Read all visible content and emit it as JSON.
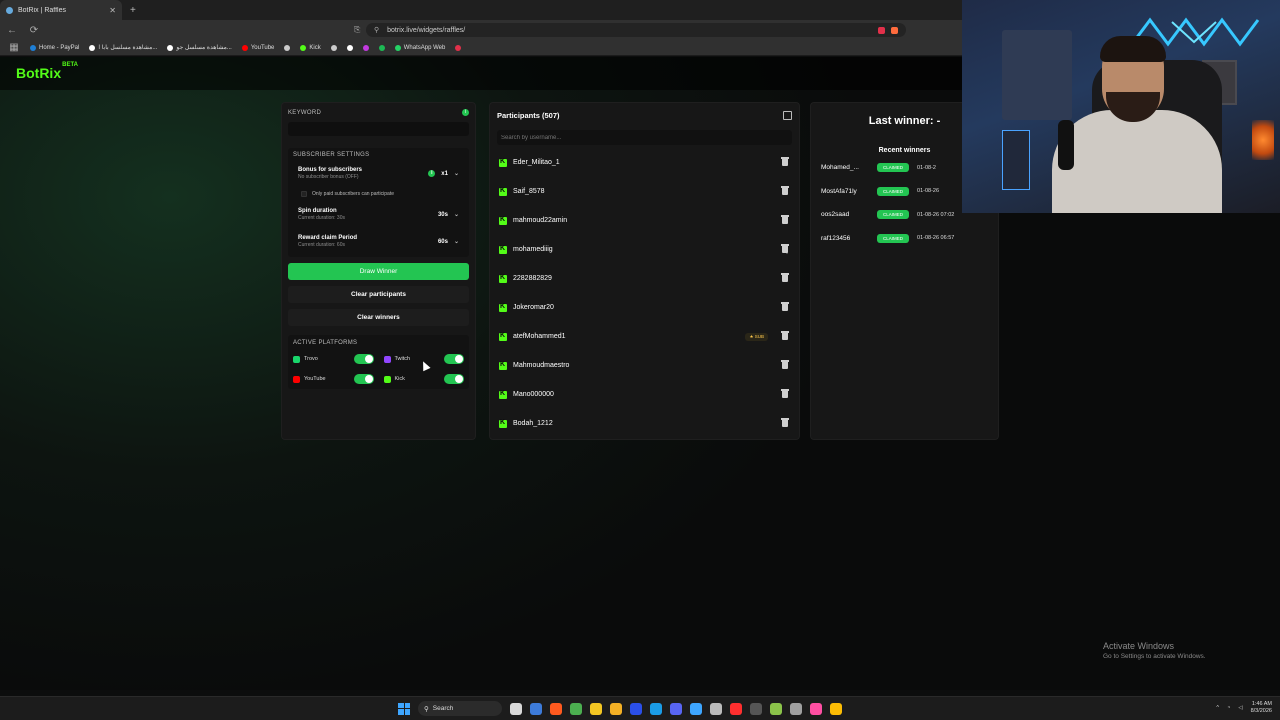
{
  "browser": {
    "tab_title": "BotRix | Raffles",
    "tab_close": "✕",
    "new_tab": "+",
    "url": "botrix.live/widgets/raffles/",
    "bookmarks": [
      {
        "label": "Home - PayPal",
        "color": "#1e7fd6"
      },
      {
        "label": "مشاهدة مسلسل بابا ا...",
        "color": "#ffffff"
      },
      {
        "label": "مشاهدة مسلسل جو...",
        "color": "#ffffff"
      },
      {
        "label": "YouTube",
        "color": "#ff0000"
      },
      {
        "label": "",
        "color": "#cccccc"
      },
      {
        "label": "Kick",
        "color": "#53fc18"
      },
      {
        "label": "",
        "color": "#cccccc"
      },
      {
        "label": "",
        "color": "#ffffff"
      },
      {
        "label": "",
        "color": "#c23adf"
      },
      {
        "label": "",
        "color": "#1db954"
      },
      {
        "label": "WhatsApp Web",
        "color": "#25d366"
      },
      {
        "label": "",
        "color": "#e2304a"
      }
    ]
  },
  "app": {
    "logo": "BotRix",
    "logo_badge": "BETA"
  },
  "left_panel": {
    "keyword_label": "KEYWORD",
    "keyword_value": "",
    "subscriber_settings_label": "SUBSCRIBER SETTINGS",
    "bonus_title": "Bonus for subscribers",
    "bonus_desc": "No subscriber bonus (OFF)",
    "bonus_value": "x1",
    "paid_only_label": "Only paid subscribers can participate",
    "spin_title": "Spin duration",
    "spin_desc": "Current duration: 30s",
    "spin_value": "30s",
    "reward_title": "Reward claim Period",
    "reward_desc": "Current duration: 60s",
    "reward_value": "60s",
    "draw_winner": "Draw Winner",
    "clear_participants": "Clear participants",
    "clear_winners": "Clear winners",
    "active_platforms_label": "ACTIVE PLATFORMS",
    "platforms": [
      {
        "name": "Trovo",
        "color": "#19d66b",
        "enabled": true
      },
      {
        "name": "Twitch",
        "color": "#9146ff",
        "enabled": true
      },
      {
        "name": "YouTube",
        "color": "#ff0000",
        "enabled": true
      },
      {
        "name": "Kick",
        "color": "#53fc18",
        "enabled": true
      }
    ]
  },
  "participants": {
    "title": "Participants (507)",
    "search_placeholder": "Search by username...",
    "sub_badge": "★ SUB",
    "list": [
      {
        "name": "Eder_Militao_1",
        "sub": false
      },
      {
        "name": "Saif_8578",
        "sub": false
      },
      {
        "name": "mahmoud22amin",
        "sub": false
      },
      {
        "name": "mohamediiig",
        "sub": false
      },
      {
        "name": "2282882829",
        "sub": false
      },
      {
        "name": "Jokeromar20",
        "sub": false
      },
      {
        "name": "atefMohammed1",
        "sub": true
      },
      {
        "name": "Mahmoudmaestro",
        "sub": false
      },
      {
        "name": "Mano000000",
        "sub": false
      },
      {
        "name": "Bodah_1212",
        "sub": false
      }
    ]
  },
  "winners": {
    "last_winner": "Last winner: -",
    "recent_title": "Recent winners",
    "status_label": "CLAIMED",
    "list": [
      {
        "name": "Mohamed_...",
        "time": "01-08-2"
      },
      {
        "name": "MostAfa71ly",
        "time": "01-08-26"
      },
      {
        "name": "oos2saad",
        "time": "01-08-26 07:02"
      },
      {
        "name": "raf123456",
        "time": "01-08-26 06:57"
      }
    ]
  },
  "watermark": {
    "line1": "Activate Windows",
    "line2": "Go to Settings to activate Windows."
  },
  "taskbar": {
    "search": "Search",
    "time": "1:46 AM",
    "date": "8/3/2026",
    "icons": [
      "#d9d9d9",
      "#3d7bd9",
      "#ff5a1f",
      "#4caf50",
      "#f3c623",
      "#f3b025",
      "#2b4fe8",
      "#1b9ce6",
      "#5865f2",
      "#3ea6ff",
      "#bbbbbb",
      "#ff2f2f",
      "#555555",
      "#8bc34a",
      "#a0a0a0",
      "#ff4fa3",
      "#fbbc05"
    ]
  }
}
